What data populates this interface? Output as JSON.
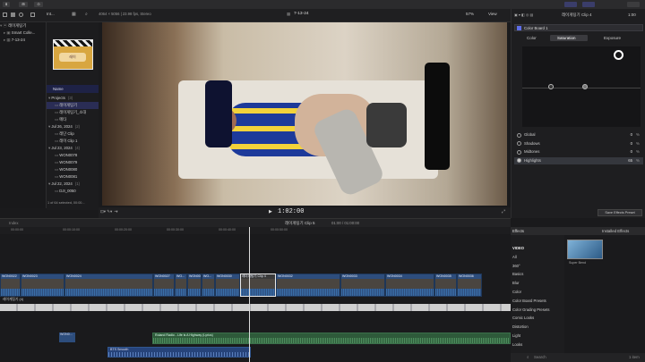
{
  "topbar": {
    "btn1": "⬇",
    "btn2": "⊞",
    "btn3": "⊙"
  },
  "libraries": {
    "items": [
      "레이게팅기",
      "Smart Colle...",
      "7-13-24"
    ]
  },
  "browser": {
    "title": "Int...",
    "resolution": "4064 × 5056 | 23.98 fps, Stereo",
    "heading": "Name"
  },
  "events": {
    "rows": [
      {
        "label": "Projects",
        "count": "(3)",
        "kind": "group"
      },
      {
        "label": "레이게팅기",
        "kind": "item"
      },
      {
        "label": "레이게팅기_소대",
        "kind": "item"
      },
      {
        "label": "메타",
        "kind": "item"
      },
      {
        "label": "Jul 26, 2024",
        "count": "(2)",
        "kind": "group"
      },
      {
        "label": "레단 Clip",
        "kind": "item"
      },
      {
        "label": "레이 Clip 1",
        "kind": "item"
      },
      {
        "label": "Jul 23, 2024",
        "count": "(4)",
        "kind": "group"
      },
      {
        "label": "WON0078",
        "kind": "item"
      },
      {
        "label": "WON0079",
        "kind": "item"
      },
      {
        "label": "WON0080",
        "kind": "item"
      },
      {
        "label": "WON0081",
        "kind": "item"
      },
      {
        "label": "Jul 22, 2024",
        "count": "(1)",
        "kind": "group"
      },
      {
        "label": "DJI_0050",
        "kind": "item"
      }
    ],
    "status": "1 of 64 selected, 00:00..."
  },
  "viewer": {
    "title": "7-13-24",
    "zoom": "57%",
    "view_label": "View",
    "timecode": "1:02:00",
    "filmstrip_label": "Clip Label"
  },
  "inspector": {
    "clip_title": "레이게팅기 Clip 4",
    "duration": "1:00",
    "effect_name": "Color Board 1",
    "tabs": [
      "Color",
      "Saturation",
      "Exposure"
    ],
    "params": [
      {
        "label": "Global",
        "value": "0",
        "unit": "%"
      },
      {
        "label": "Shadows",
        "value": "0",
        "unit": "%"
      },
      {
        "label": "Midtones",
        "value": "0",
        "unit": "%"
      },
      {
        "label": "Highlights",
        "value": "65",
        "unit": "%"
      }
    ],
    "save_button": "Save Effects Preset"
  },
  "timeline": {
    "index": "Index",
    "title": "레이게팅기 Clip 5",
    "time": "01:00 / 01:00:00",
    "ruler": [
      "00:00:00",
      "00:00:10:00",
      "00:00:20:00",
      "00:00:30:00",
      "00:00:40:00",
      "00:00:50:00"
    ],
    "clips": [
      "WON0022",
      "WON0023",
      "WON0024",
      "WON0027",
      "WO...",
      "WON0029",
      "WO...",
      "WON0030",
      "WON0032",
      "WON0033",
      "WON0034",
      "WON0035",
      "WON0036",
      "레이게팅기 Clip 4"
    ],
    "title_clip": "레이게팅기 (4)",
    "audio1": "Roland Radio - Life is A Highway (Lyrics)",
    "audio2": "BTS Smooth",
    "audio_small": "WON0..."
  },
  "effects": {
    "header": "Effects",
    "installed": "Installed Effects",
    "categories": [
      "VIDEO",
      "All",
      "360°",
      "Basics",
      "Blur",
      "Color",
      "Color Board Presets",
      "Color Grading Presets",
      "Comic Looks",
      "Distortion",
      "Light",
      "Looks"
    ],
    "thumb_label": "Super Bend",
    "search_placeholder": "Search",
    "count": "1 item"
  },
  "colors": {
    "accent": "#5e6ee8",
    "clip_blue": "#2d4d7c",
    "viewer_bg": "#000000"
  }
}
